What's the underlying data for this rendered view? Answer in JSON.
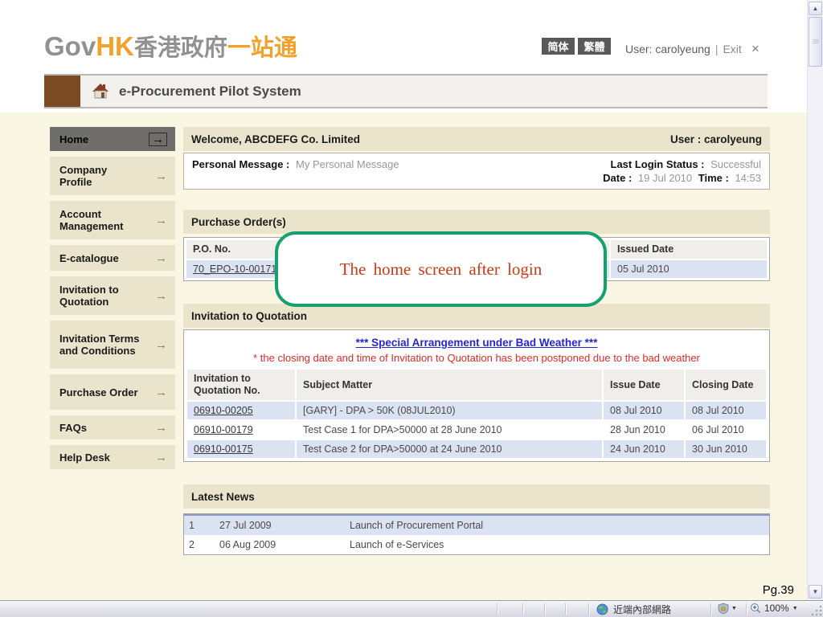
{
  "header": {
    "logo": {
      "gov": "Gov",
      "hk": "HK",
      "chinese_gray": "香港政府",
      "chinese_orange": "一站通"
    },
    "lang_simplified": "简体",
    "lang_traditional": "繁體",
    "user_text": "User: carolyeung",
    "divider": "|",
    "exit_label": "Exit"
  },
  "banner": {
    "title": "e-Procurement Pilot System"
  },
  "sidebar": {
    "items": [
      {
        "label": "Home",
        "active": true
      },
      {
        "label": "Company Profile"
      },
      {
        "label": "Account Management"
      },
      {
        "label": "E-catalogue"
      },
      {
        "label": "Invitation to Quotation"
      },
      {
        "label": "Invitation Terms and Conditions"
      },
      {
        "label": "Purchase Order"
      },
      {
        "label": "FAQs"
      },
      {
        "label": "Help Desk"
      }
    ]
  },
  "welcome": {
    "title": "Welcome, ABCDEFG Co. Limited",
    "user": "User : carolyeung"
  },
  "personal": {
    "message_label": "Personal Message :",
    "message_value": "My Personal Message",
    "login_status_label": "Last Login Status :",
    "login_status_value": "Successful",
    "date_label": "Date :",
    "date_value": "19 Jul 2010",
    "time_label": "Time :",
    "time_value": "14:53"
  },
  "purchase_orders": {
    "section_title": "Purchase Order(s)",
    "columns": [
      "P.O. No.",
      "Issued Date"
    ],
    "rows": [
      {
        "po_no": "70_EPO-10-00171",
        "issued_date": "05 Jul 2010"
      }
    ]
  },
  "invitation": {
    "section_title": "Invitation to Quotation",
    "special_link": "*** Special Arrangement under Bad Weather ***",
    "notice": "* the closing date and time of Invitation to Quotation has been postponed due to the bad weather",
    "columns": [
      "Invitation to Quotation No.",
      "Subject Matter",
      "Issue Date",
      "Closing Date"
    ],
    "rows": [
      {
        "no": "06910-00205",
        "subject": "[GARY] - DPA > 50K (08JUL2010)",
        "issue": "08 Jul 2010",
        "closing": "08 Jul 2010"
      },
      {
        "no": "06910-00179",
        "subject": "Test Case 1 for DPA>50000 at 28 June 2010",
        "issue": "28 Jun 2010",
        "closing": "06 Jul 2010"
      },
      {
        "no": "06910-00175",
        "subject": "Test Case 2 for DPA>50000 at 24 June 2010",
        "issue": "24 Jun 2010",
        "closing": "30 Jun 2010"
      }
    ]
  },
  "news": {
    "section_title": "Latest News",
    "rows": [
      {
        "num": "1",
        "date": "27 Jul 2009",
        "title": "Launch of Procurement Portal"
      },
      {
        "num": "2",
        "date": "06 Aug 2009",
        "title": "Launch of e-Services"
      }
    ]
  },
  "callout": {
    "text": "The  home screen after login"
  },
  "slide": {
    "page_label": "Pg.39"
  },
  "statusbar": {
    "zone_text": "近端內部網路",
    "zoom_level": "100%"
  },
  "icons": {
    "arrow_right": "→",
    "close": "×",
    "caret_down": "▼",
    "scroll_up": "▲",
    "scroll_down": "▼"
  },
  "colors": {
    "brand_orange": "#f2a22b",
    "brand_gray": "#919191",
    "brown_block": "#7a4a23",
    "section_beige": "#e9e4cb",
    "active_item_gray": "#6f6e6c",
    "row_highlight_blue": "#dbe2f1",
    "link_blue": "#2626cf",
    "notice_red": "#e02a2a",
    "callout_border_green": "#15a16c",
    "callout_text_red": "#c93a16"
  }
}
